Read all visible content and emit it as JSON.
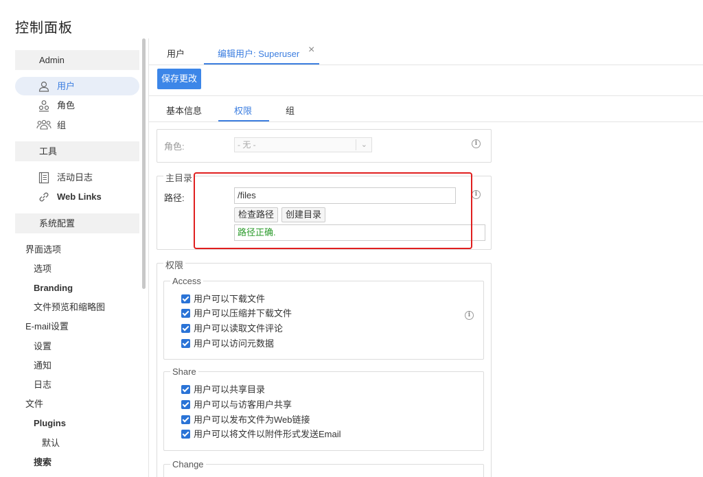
{
  "page_title": "控制面板",
  "sidebar": {
    "admin_header": "Admin",
    "users": "用户",
    "roles": "角色",
    "groups": "组",
    "tools_header": "工具",
    "activity_log": "活动日志",
    "web_links": "Web Links",
    "system_header": "系统配置",
    "ui_options": "界面选项",
    "options": "选项",
    "branding": "Branding",
    "file_preview": "文件预览和缩略图",
    "email_settings": "E-mail设置",
    "settings": "设置",
    "notifications": "通知",
    "logs": "日志",
    "files": "文件",
    "plugins": "Plugins",
    "default": "默认",
    "search": "搜索"
  },
  "tabs": {
    "users": "用户",
    "edit_user": "编辑用户: Superuser",
    "close": "×"
  },
  "toolbar": {
    "save": "保存更改"
  },
  "subtabs": {
    "basic": "基本信息",
    "permissions": "权限",
    "groups": "组"
  },
  "role": {
    "label": "角色:",
    "value": "- 无 -"
  },
  "home": {
    "legend": "主目录",
    "path_label": "路径:",
    "path_value": "/files",
    "check_path": "检查路径",
    "create_dir": "创建目录",
    "status": "路径正确."
  },
  "perms": {
    "legend": "权限",
    "access_legend": "Access",
    "access": [
      "用户可以下载文件",
      "用户可以压缩并下载文件",
      "用户可以读取文件评论",
      "用户可以访问元数据"
    ],
    "share_legend": "Share",
    "share": [
      "用户可以共享目录",
      "用户可以与访客用户共享",
      "用户可以发布文件为Web链接",
      "用户可以将文件以附件形式发送Email"
    ],
    "change_legend": "Change"
  },
  "colors": {
    "accent": "#3c7ee0",
    "highlight": "#e01e1e",
    "ok": "#2a9a2a"
  }
}
